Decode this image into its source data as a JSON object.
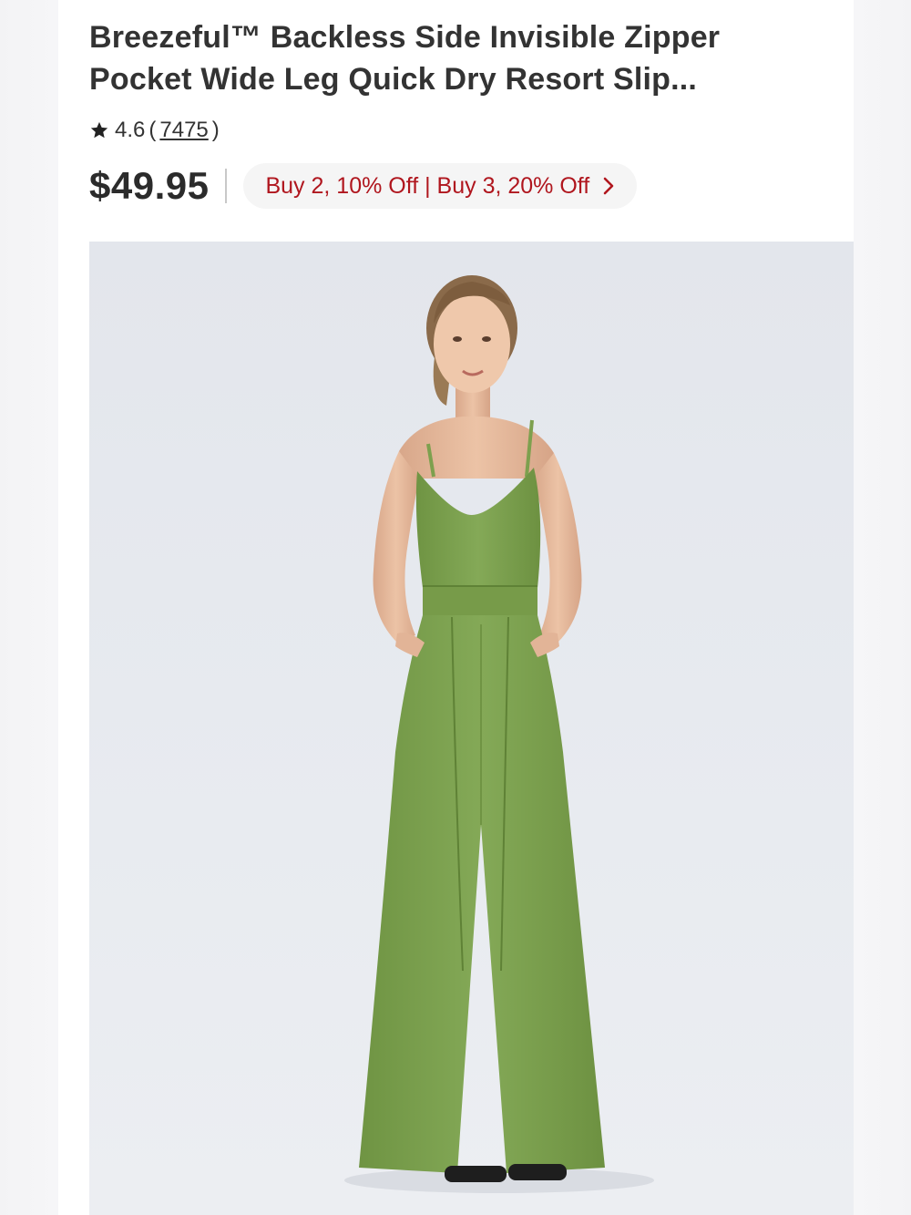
{
  "product": {
    "title": "Breezeful™ Backless Side Invisible Zipper Pocket Wide Leg Quick Dry Resort Slip...",
    "rating": "4.6",
    "review_open": "(",
    "review_count": "7475",
    "review_close": ")",
    "price": "$49.95",
    "promo": "Buy 2, 10% Off | Buy 3, 20% Off"
  },
  "icons": {
    "rating": "star-icon",
    "promo": "chevron-right-icon"
  },
  "colors": {
    "promo_text": "#b0161e",
    "jumpsuit": "#7da04e",
    "image_background": "#e5e8ee"
  }
}
